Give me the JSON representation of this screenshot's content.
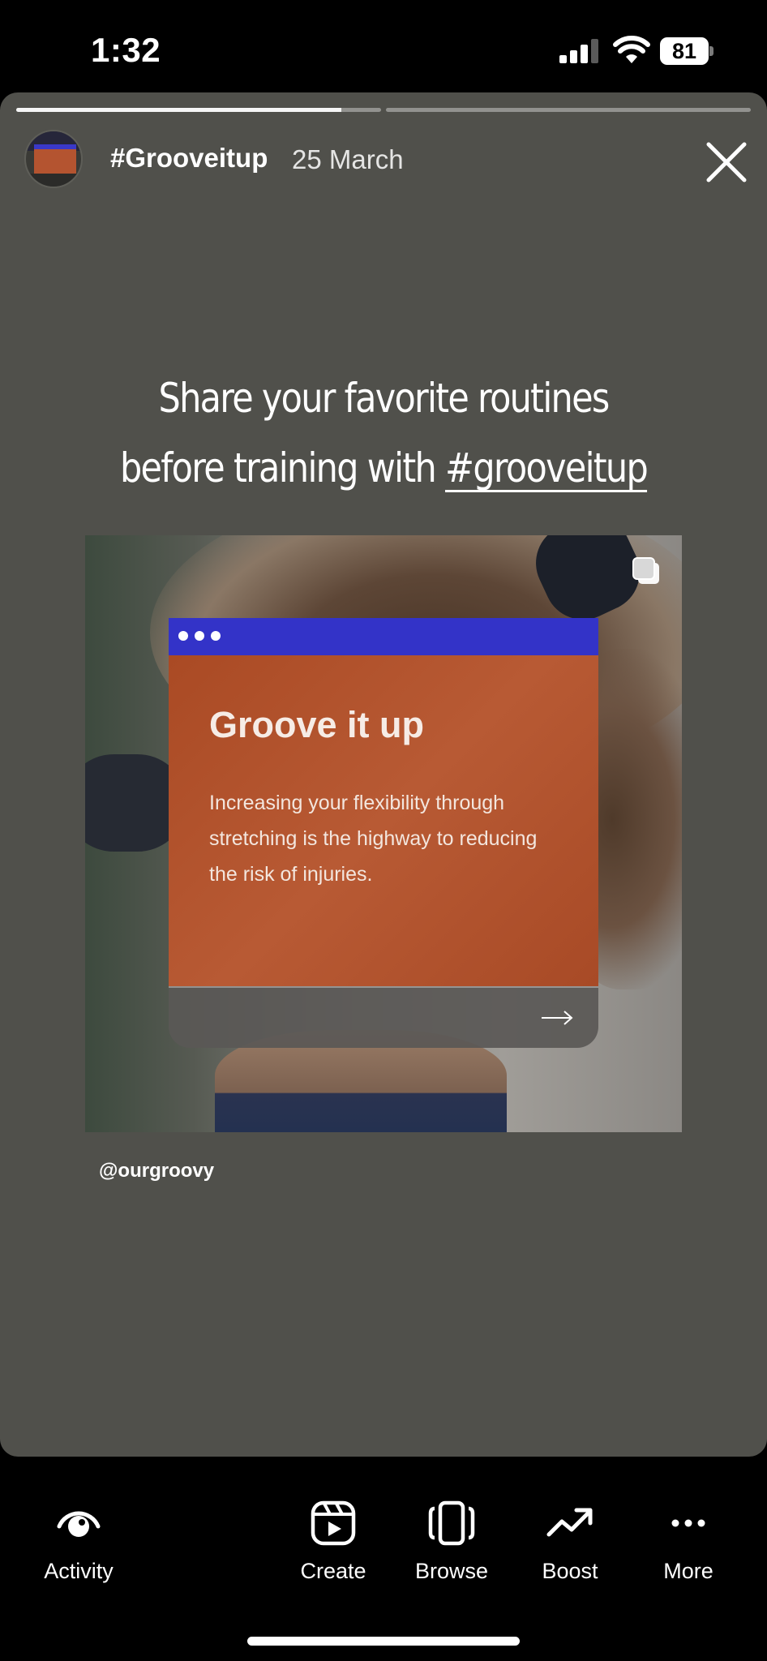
{
  "status_bar": {
    "time": "1:32",
    "battery": "81",
    "icons": [
      "cellular-signal-icon",
      "wifi-icon",
      "battery-icon"
    ]
  },
  "story": {
    "progress": [
      0.89,
      0
    ],
    "username": "#Grooveitup",
    "date": "25 March",
    "headline_line1": "Share your favorite routines",
    "headline_line2_prefix": "before training with ",
    "headline_hashtag": "#grooveitup",
    "post": {
      "card_title": "Groove it up",
      "card_text": "Increasing your flexibility through stretching is the highway to reducing the risk of injuries.",
      "handle": "@ourgroovy"
    },
    "colors": {
      "background": "#50504b",
      "card_header": "#3333c8",
      "card_body": "#b24e28"
    }
  },
  "bottom_bar": {
    "tabs": [
      {
        "label": "Activity",
        "icon": "eye-icon"
      },
      {
        "label": "Create",
        "icon": "reels-icon"
      },
      {
        "label": "Browse",
        "icon": "carousel-icon"
      },
      {
        "label": "Boost",
        "icon": "trending-up-icon"
      },
      {
        "label": "More",
        "icon": "more-horizontal-icon"
      }
    ]
  }
}
